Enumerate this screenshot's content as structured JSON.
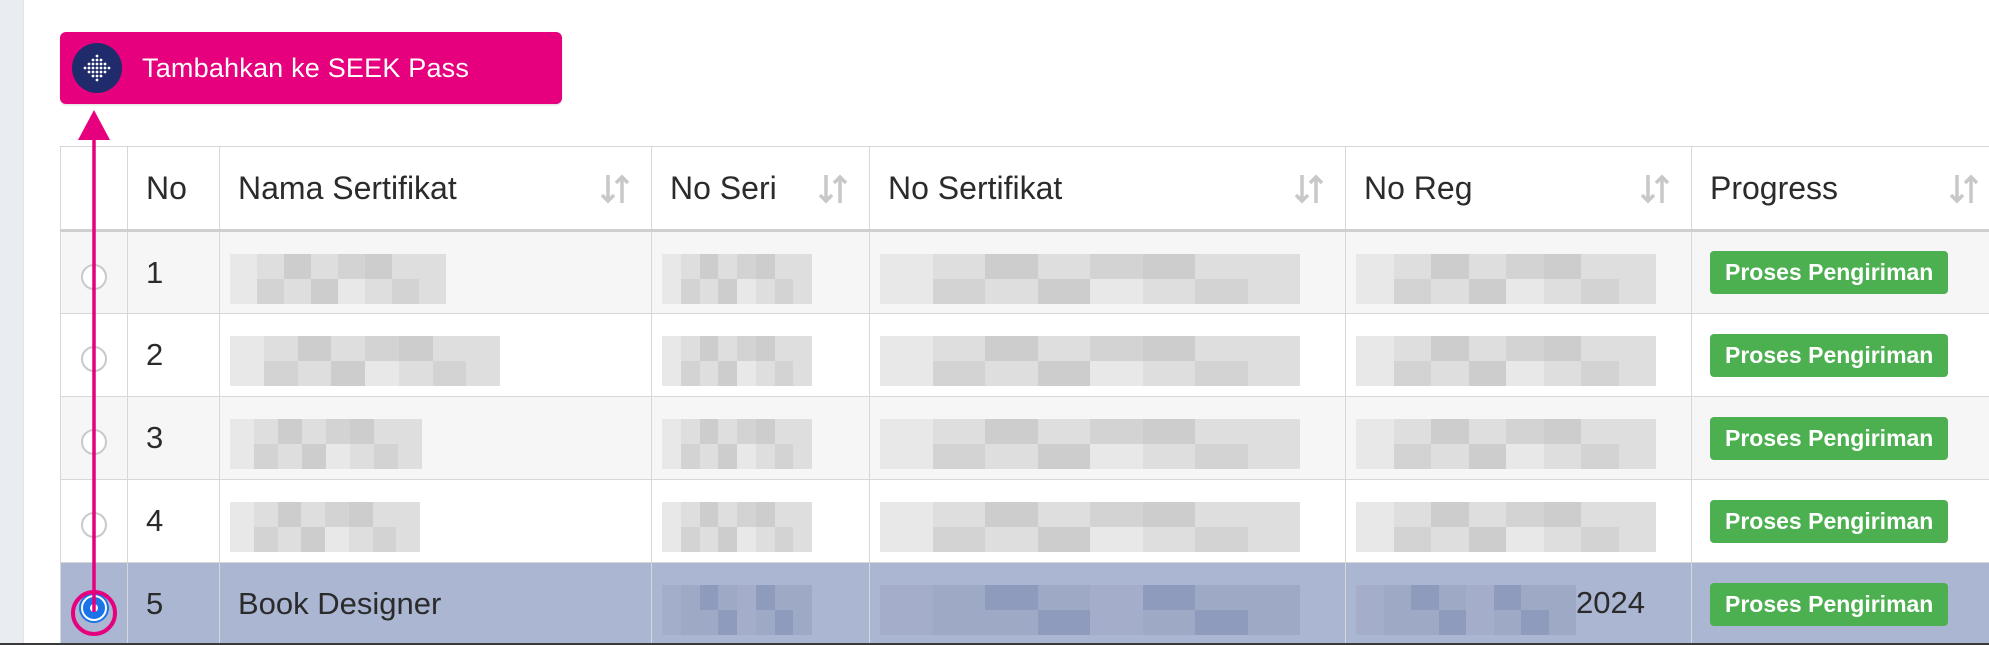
{
  "seek_button": {
    "label": "Tambahkan ke SEEK Pass",
    "icon": "seek-logo-icon",
    "color": "#e6007e"
  },
  "table": {
    "headers": {
      "no": "No",
      "nama_sertifikat": "Nama Sertifikat",
      "no_seri": "No Seri",
      "no_sertifikat": "No Sertifikat",
      "no_reg": "No Reg",
      "progress": "Progress"
    },
    "rows": [
      {
        "no": "1",
        "nama": "",
        "no_reg_suffix": "",
        "progress": "Proses Pengiriman",
        "selected": false
      },
      {
        "no": "2",
        "nama": "",
        "no_reg_suffix": "",
        "progress": "Proses Pengiriman",
        "selected": false
      },
      {
        "no": "3",
        "nama": "",
        "no_reg_suffix": "",
        "progress": "Proses Pengiriman",
        "selected": false
      },
      {
        "no": "4",
        "nama": "",
        "no_reg_suffix": "",
        "progress": "Proses Pengiriman",
        "selected": false
      },
      {
        "no": "5",
        "nama": "Book Designer",
        "no_reg_suffix": "2024",
        "progress": "Proses Pengiriman",
        "selected": true
      }
    ],
    "colors": {
      "selected_row": "#aab6d2",
      "badge": "#4cb050",
      "radio_checked": "#1a73e8"
    }
  },
  "annotation_color": "#e6007e"
}
